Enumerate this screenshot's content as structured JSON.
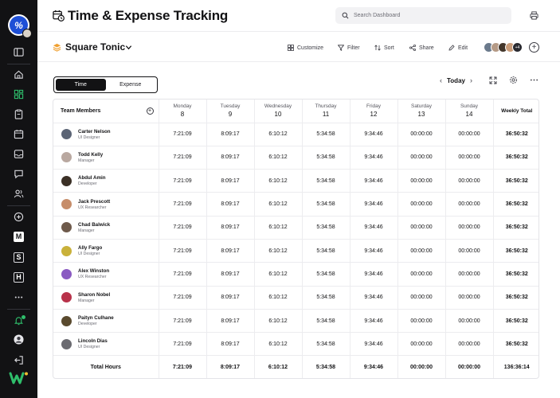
{
  "header": {
    "title": "Time & Expense Tracking",
    "search_placeholder": "Search Dashboard"
  },
  "workspace": {
    "name": "Square Tonic",
    "tools": [
      "Customize",
      "Filter",
      "Sort",
      "Share",
      "Edit"
    ],
    "avatars_more": "+4"
  },
  "view_toggle": {
    "options": [
      "Time",
      "Expense"
    ],
    "selected": "Time"
  },
  "date_nav": {
    "label": "Today"
  },
  "table": {
    "member_header": "Team Members",
    "weekly_header": "Weekly Total",
    "days": [
      {
        "day": "Monday",
        "date": "8"
      },
      {
        "day": "Tuesday",
        "date": "9"
      },
      {
        "day": "Wednesday",
        "date": "10"
      },
      {
        "day": "Thursday",
        "date": "11"
      },
      {
        "day": "Friday",
        "date": "12"
      },
      {
        "day": "Saturday",
        "date": "13"
      },
      {
        "day": "Sunday",
        "date": "14"
      }
    ],
    "rows": [
      {
        "name": "Carter Nelson",
        "role": "UI Designer",
        "times": [
          "7:21:09",
          "8:09:17",
          "6:10:12",
          "5:34:58",
          "9:34:46",
          "00:00:00",
          "00:00:00"
        ],
        "total": "36:50:32",
        "avatar_color": "#5b6475"
      },
      {
        "name": "Todd Kelly",
        "role": "Manager",
        "times": [
          "7:21:09",
          "8:09:17",
          "6:10:12",
          "5:34:58",
          "9:34:46",
          "00:00:00",
          "00:00:00"
        ],
        "total": "36:50:32",
        "avatar_color": "#b9a8a0"
      },
      {
        "name": "Abdul Amin",
        "role": "Developer",
        "times": [
          "7:21:09",
          "8:09:17",
          "6:10:12",
          "5:34:58",
          "9:34:46",
          "00:00:00",
          "00:00:00"
        ],
        "total": "36:50:32",
        "avatar_color": "#3b3026"
      },
      {
        "name": "Jack Prescott",
        "role": "UX Researcher",
        "times": [
          "7:21:09",
          "8:09:17",
          "6:10:12",
          "5:34:58",
          "9:34:46",
          "00:00:00",
          "00:00:00"
        ],
        "total": "36:50:32",
        "avatar_color": "#c68d6a"
      },
      {
        "name": "Chad Balwick",
        "role": "Manager",
        "times": [
          "7:21:09",
          "8:09:17",
          "6:10:12",
          "5:34:58",
          "9:34:46",
          "00:00:00",
          "00:00:00"
        ],
        "total": "36:50:32",
        "avatar_color": "#6e5a4b"
      },
      {
        "name": "Ally Fargo",
        "role": "UI Designer",
        "times": [
          "7:21:09",
          "8:09:17",
          "6:10:12",
          "5:34:58",
          "9:34:46",
          "00:00:00",
          "00:00:00"
        ],
        "total": "36:50:32",
        "avatar_color": "#c9b13a"
      },
      {
        "name": "Alex Winston",
        "role": "UX Researcher",
        "times": [
          "7:21:09",
          "8:09:17",
          "6:10:12",
          "5:34:58",
          "9:34:46",
          "00:00:00",
          "00:00:00"
        ],
        "total": "36:50:32",
        "avatar_color": "#8a5ac2"
      },
      {
        "name": "Sharon Nobel",
        "role": "Manager",
        "times": [
          "7:21:09",
          "8:09:17",
          "6:10:12",
          "5:34:58",
          "9:34:46",
          "00:00:00",
          "00:00:00"
        ],
        "total": "36:50:32",
        "avatar_color": "#b8324a"
      },
      {
        "name": "Paityn Culhane",
        "role": "Developer",
        "times": [
          "7:21:09",
          "8:09:17",
          "6:10:12",
          "5:34:58",
          "9:34:46",
          "00:00:00",
          "00:00:00"
        ],
        "total": "36:50:32",
        "avatar_color": "#5a4a2e"
      },
      {
        "name": "Lincoln Dias",
        "role": "UI Designer",
        "times": [
          "7:21:09",
          "8:09:17",
          "6:10:12",
          "5:34:58",
          "9:34:46",
          "00:00:00",
          "00:00:00"
        ],
        "total": "36:50:32",
        "avatar_color": "#6a6a70"
      }
    ],
    "totals_label": "Total Hours",
    "totals": [
      "7:21:09",
      "8:09:17",
      "6:10:12",
      "5:34:58",
      "9:34:46",
      "00:00:00",
      "00:00:00"
    ],
    "grand_total": "136:36:14"
  },
  "colors": {
    "sidebar_bg": "#121214",
    "accent_blue": "#1e4fd6",
    "accent_green": "#2fbe6b",
    "ws_orange": "#f0a030"
  }
}
